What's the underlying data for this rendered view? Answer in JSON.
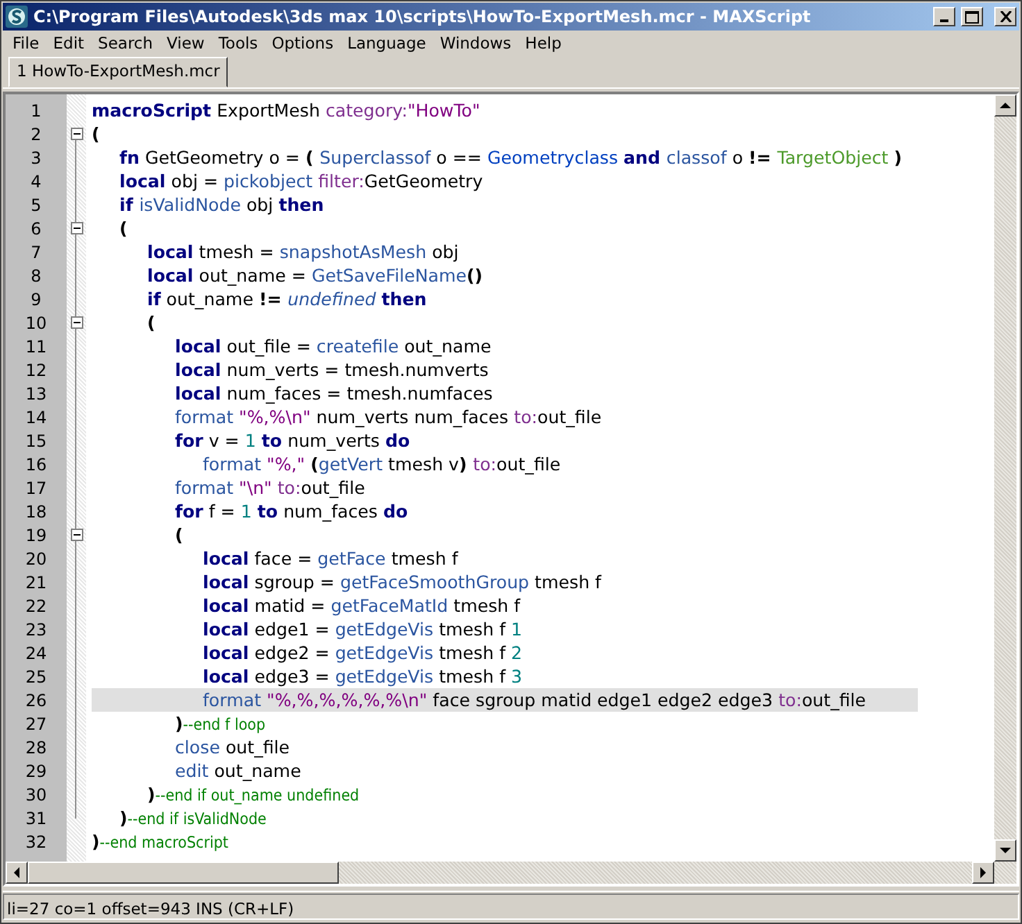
{
  "window": {
    "title": "C:\\Program Files\\Autodesk\\3ds max 10\\scripts\\HowTo-ExportMesh.mcr - MAXScript"
  },
  "menu": [
    "File",
    "Edit",
    "Search",
    "View",
    "Tools",
    "Options",
    "Language",
    "Windows",
    "Help"
  ],
  "tabs": [
    {
      "label": "1 HowTo-ExportMesh.mcr",
      "selected": true
    }
  ],
  "editor": {
    "lines": [
      {
        "number": "1",
        "tokens": [
          {
            "kind": "keyword",
            "text": "macroScript"
          },
          {
            "kind": "plain",
            "text": " ExportMesh "
          },
          {
            "kind": "param",
            "text": "category:"
          },
          {
            "kind": "string",
            "text": "\"HowTo\""
          }
        ]
      },
      {
        "number": "2",
        "expanded": true,
        "tokens": [
          {
            "kind": "punct",
            "text": "("
          }
        ],
        "children": [
          {
            "number": "3",
            "tokens": [
              {
                "kind": "keyword",
                "text": "fn"
              },
              {
                "kind": "plain",
                "text": " GetGeometry o = "
              },
              {
                "kind": "punct",
                "text": "( "
              },
              {
                "kind": "builtin",
                "text": "Superclassof"
              },
              {
                "kind": "plain",
                "text": " o == "
              },
              {
                "kind": "class",
                "text": "Geometryclass "
              },
              {
                "kind": "keyword",
                "text": "and "
              },
              {
                "kind": "builtin",
                "text": "classof"
              },
              {
                "kind": "plain",
                "text": " o "
              },
              {
                "kind": "punct",
                "text": "!= "
              },
              {
                "kind": "type",
                "text": "TargetObject "
              },
              {
                "kind": "punct",
                "text": ")"
              }
            ]
          },
          {
            "number": "4",
            "tokens": [
              {
                "kind": "keyword",
                "text": "local"
              },
              {
                "kind": "plain",
                "text": " obj = "
              },
              {
                "kind": "builtin",
                "text": "pickobject "
              },
              {
                "kind": "param",
                "text": "filter:"
              },
              {
                "kind": "plain",
                "text": "GetGeometry"
              }
            ]
          },
          {
            "number": "5",
            "tokens": [
              {
                "kind": "keyword",
                "text": "if "
              },
              {
                "kind": "builtin",
                "text": "isValidNode"
              },
              {
                "kind": "plain",
                "text": " obj "
              },
              {
                "kind": "keyword",
                "text": "then"
              }
            ]
          },
          {
            "number": "6",
            "expanded": true,
            "tokens": [
              {
                "kind": "punct",
                "text": "("
              }
            ],
            "children": [
              {
                "number": "7",
                "tokens": [
                  {
                    "kind": "keyword",
                    "text": "local"
                  },
                  {
                    "kind": "plain",
                    "text": " tmesh = "
                  },
                  {
                    "kind": "builtin",
                    "text": "snapshotAsMesh"
                  },
                  {
                    "kind": "plain",
                    "text": " obj"
                  }
                ]
              },
              {
                "number": "8",
                "tokens": [
                  {
                    "kind": "keyword",
                    "text": "local"
                  },
                  {
                    "kind": "plain",
                    "text": " out_name = "
                  },
                  {
                    "kind": "builtin",
                    "text": "GetSaveFileName"
                  },
                  {
                    "kind": "punct",
                    "text": "()"
                  }
                ]
              },
              {
                "number": "9",
                "tokens": [
                  {
                    "kind": "keyword",
                    "text": "if"
                  },
                  {
                    "kind": "plain",
                    "text": " out_name "
                  },
                  {
                    "kind": "punct",
                    "text": "!= "
                  },
                  {
                    "kind": "italic",
                    "text": "undefined "
                  },
                  {
                    "kind": "keyword",
                    "text": "then"
                  }
                ]
              },
              {
                "number": "10",
                "expanded": true,
                "tokens": [
                  {
                    "kind": "punct",
                    "text": "("
                  }
                ],
                "children": [
                  {
                    "number": "11",
                    "tokens": [
                      {
                        "kind": "keyword",
                        "text": "local"
                      },
                      {
                        "kind": "plain",
                        "text": " out_file = "
                      },
                      {
                        "kind": "builtin",
                        "text": "createfile"
                      },
                      {
                        "kind": "plain",
                        "text": " out_name"
                      }
                    ]
                  },
                  {
                    "number": "12",
                    "tokens": [
                      {
                        "kind": "keyword",
                        "text": "local"
                      },
                      {
                        "kind": "plain",
                        "text": " num_verts = tmesh.numverts"
                      }
                    ]
                  },
                  {
                    "number": "13",
                    "tokens": [
                      {
                        "kind": "keyword",
                        "text": "local"
                      },
                      {
                        "kind": "plain",
                        "text": " num_faces = tmesh.numfaces"
                      }
                    ]
                  },
                  {
                    "number": "14",
                    "tokens": [
                      {
                        "kind": "builtin",
                        "text": "format "
                      },
                      {
                        "kind": "string",
                        "text": "\"%,%\\n\""
                      },
                      {
                        "kind": "plain",
                        "text": " num_verts num_faces "
                      },
                      {
                        "kind": "param",
                        "text": "to:"
                      },
                      {
                        "kind": "plain",
                        "text": "out_file"
                      }
                    ]
                  },
                  {
                    "number": "15",
                    "tokens": [
                      {
                        "kind": "keyword",
                        "text": "for"
                      },
                      {
                        "kind": "plain",
                        "text": " v = "
                      },
                      {
                        "kind": "number",
                        "text": "1 "
                      },
                      {
                        "kind": "keyword",
                        "text": "to"
                      },
                      {
                        "kind": "plain",
                        "text": " num_verts "
                      },
                      {
                        "kind": "keyword",
                        "text": "do"
                      }
                    ],
                    "children": [
                      {
                        "number": "16",
                        "tokens": [
                          {
                            "kind": "builtin",
                            "text": "format "
                          },
                          {
                            "kind": "string",
                            "text": "\"%,\" "
                          },
                          {
                            "kind": "punct",
                            "text": "("
                          },
                          {
                            "kind": "builtin",
                            "text": "getVert"
                          },
                          {
                            "kind": "plain",
                            "text": " tmesh v"
                          },
                          {
                            "kind": "punct",
                            "text": ") "
                          },
                          {
                            "kind": "param",
                            "text": "to:"
                          },
                          {
                            "kind": "plain",
                            "text": "out_file"
                          }
                        ]
                      }
                    ]
                  },
                  {
                    "number": "17",
                    "tokens": [
                      {
                        "kind": "builtin",
                        "text": "format "
                      },
                      {
                        "kind": "string",
                        "text": "\"\\n\" "
                      },
                      {
                        "kind": "param",
                        "text": "to:"
                      },
                      {
                        "kind": "plain",
                        "text": "out_file"
                      }
                    ]
                  },
                  {
                    "number": "18",
                    "tokens": [
                      {
                        "kind": "keyword",
                        "text": "for"
                      },
                      {
                        "kind": "plain",
                        "text": " f = "
                      },
                      {
                        "kind": "number",
                        "text": "1 "
                      },
                      {
                        "kind": "keyword",
                        "text": "to"
                      },
                      {
                        "kind": "plain",
                        "text": " num_faces "
                      },
                      {
                        "kind": "keyword",
                        "text": "do"
                      }
                    ]
                  },
                  {
                    "number": "19",
                    "expanded": true,
                    "tokens": [
                      {
                        "kind": "punct",
                        "text": "("
                      }
                    ],
                    "children": [
                      {
                        "number": "20",
                        "tokens": [
                          {
                            "kind": "keyword",
                            "text": "local"
                          },
                          {
                            "kind": "plain",
                            "text": " face = "
                          },
                          {
                            "kind": "builtin",
                            "text": "getFace"
                          },
                          {
                            "kind": "plain",
                            "text": " tmesh f"
                          }
                        ]
                      },
                      {
                        "number": "21",
                        "tokens": [
                          {
                            "kind": "keyword",
                            "text": "local"
                          },
                          {
                            "kind": "plain",
                            "text": " sgroup = "
                          },
                          {
                            "kind": "builtin",
                            "text": "getFaceSmoothGroup"
                          },
                          {
                            "kind": "plain",
                            "text": " tmesh f"
                          }
                        ]
                      },
                      {
                        "number": "22",
                        "tokens": [
                          {
                            "kind": "keyword",
                            "text": "local"
                          },
                          {
                            "kind": "plain",
                            "text": " matid = "
                          },
                          {
                            "kind": "builtin",
                            "text": "getFaceMatId"
                          },
                          {
                            "kind": "plain",
                            "text": " tmesh f"
                          }
                        ]
                      },
                      {
                        "number": "23",
                        "tokens": [
                          {
                            "kind": "keyword",
                            "text": "local"
                          },
                          {
                            "kind": "plain",
                            "text": " edge1 = "
                          },
                          {
                            "kind": "builtin",
                            "text": "getEdgeVis"
                          },
                          {
                            "kind": "plain",
                            "text": " tmesh f "
                          },
                          {
                            "kind": "number",
                            "text": "1"
                          }
                        ]
                      },
                      {
                        "number": "24",
                        "tokens": [
                          {
                            "kind": "keyword",
                            "text": "local"
                          },
                          {
                            "kind": "plain",
                            "text": " edge2 = "
                          },
                          {
                            "kind": "builtin",
                            "text": "getEdgeVis"
                          },
                          {
                            "kind": "plain",
                            "text": " tmesh f "
                          },
                          {
                            "kind": "number",
                            "text": "2"
                          }
                        ]
                      },
                      {
                        "number": "25",
                        "tokens": [
                          {
                            "kind": "keyword",
                            "text": "local"
                          },
                          {
                            "kind": "plain",
                            "text": " edge3 = "
                          },
                          {
                            "kind": "builtin",
                            "text": "getEdgeVis"
                          },
                          {
                            "kind": "plain",
                            "text": " tmesh f "
                          },
                          {
                            "kind": "number",
                            "text": "3"
                          }
                        ]
                      },
                      {
                        "number": "26",
                        "current": true,
                        "tokens": [
                          {
                            "kind": "builtin",
                            "text": "format "
                          },
                          {
                            "kind": "string",
                            "text": "\"%,%,%,%,%,%\\n\""
                          },
                          {
                            "kind": "plain",
                            "text": " face sgroup matid edge1 edge2 edge3 "
                          },
                          {
                            "kind": "param",
                            "text": "to:"
                          },
                          {
                            "kind": "plain",
                            "text": "out_file"
                          }
                        ]
                      }
                    ]
                  },
                  {
                    "number": "27",
                    "tokens": [
                      {
                        "kind": "punct",
                        "text": ")"
                      },
                      {
                        "kind": "comment",
                        "text": "--end f loop"
                      }
                    ]
                  },
                  {
                    "number": "28",
                    "tokens": [
                      {
                        "kind": "builtin",
                        "text": "close"
                      },
                      {
                        "kind": "plain",
                        "text": " out_file"
                      }
                    ]
                  },
                  {
                    "number": "29",
                    "tokens": [
                      {
                        "kind": "builtin",
                        "text": "edit"
                      },
                      {
                        "kind": "plain",
                        "text": " out_name"
                      }
                    ]
                  }
                ]
              },
              {
                "number": "30",
                "tokens": [
                  {
                    "kind": "punct",
                    "text": ")"
                  },
                  {
                    "kind": "comment",
                    "text": "--end if out_name undefined"
                  }
                ]
              }
            ]
          },
          {
            "number": "31",
            "tokens": [
              {
                "kind": "punct",
                "text": ")"
              },
              {
                "kind": "comment",
                "text": "--end if isValidNode"
              }
            ]
          }
        ]
      },
      {
        "number": "32",
        "tokens": [
          {
            "kind": "punct",
            "text": ")"
          },
          {
            "kind": "comment",
            "text": "--end macroScript"
          }
        ]
      }
    ]
  },
  "status_bar": "li=27 co=1 offset=943 INS (CR+LF)"
}
